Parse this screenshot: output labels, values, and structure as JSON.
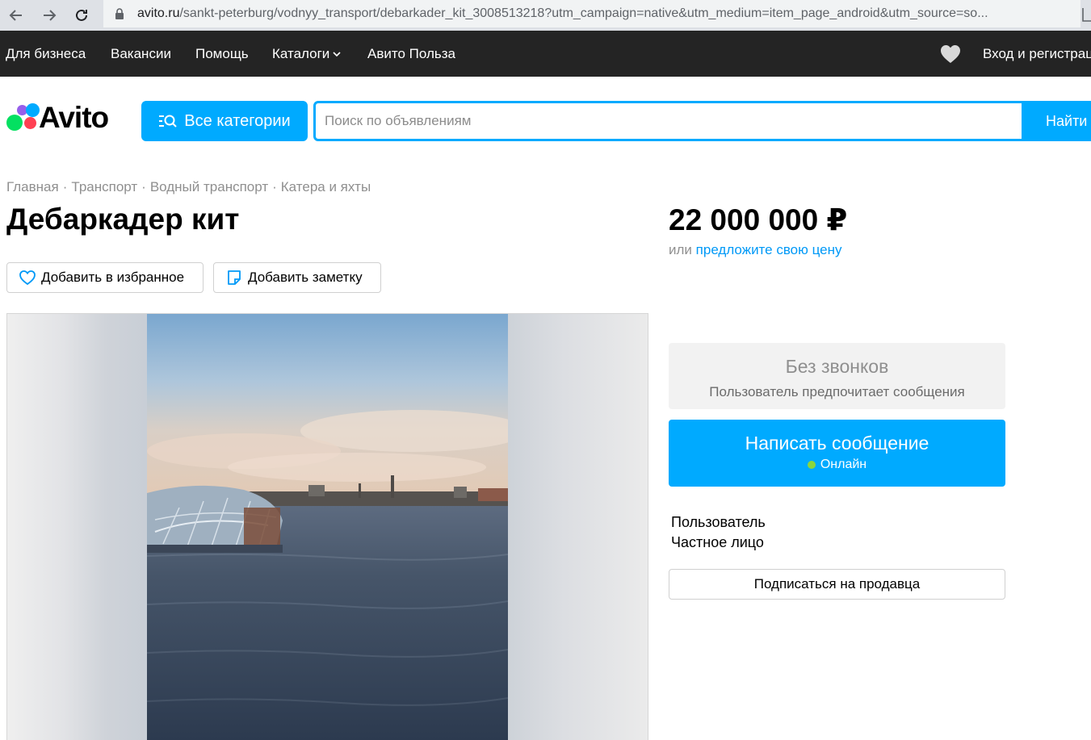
{
  "browser": {
    "url_host": "avito.ru",
    "url_path": "/sankt-peterburg/vodnyy_transport/debarkader_kit_3008513218?utm_campaign=native&utm_medium=item_page_android&utm_source=so..."
  },
  "topbar": {
    "links": [
      "Для бизнеса",
      "Вакансии",
      "Помощь",
      "Каталоги",
      "Авито Польза"
    ],
    "login": "Вход и регистрация"
  },
  "header": {
    "logo": "Avito",
    "categories_label": "Все категории",
    "search_placeholder": "Поиск по объявлениям",
    "search_button": "Найти"
  },
  "breadcrumbs": [
    "Главная",
    "Транспорт",
    "Водный транспорт",
    "Катера и яхты"
  ],
  "listing": {
    "title": "Дебаркадер кит",
    "price": "22 000 000 ₽",
    "price_or": "или",
    "price_offer": "предложите свою цену",
    "favorite_label": "Добавить в избранное",
    "note_label": "Добавить заметку"
  },
  "contact": {
    "no_calls_title": "Без звонков",
    "no_calls_sub": "Пользователь предпочитает сообщения",
    "write_label": "Написать сообщение",
    "online_label": "Онлайн"
  },
  "seller": {
    "name": "Пользователь",
    "type": "Частное лицо",
    "subscribe_label": "Подписаться на продавца"
  },
  "colors": {
    "accent": "#00aaff",
    "dark_bar": "#242424",
    "link": "#0099f7",
    "online": "#8bd63c"
  }
}
